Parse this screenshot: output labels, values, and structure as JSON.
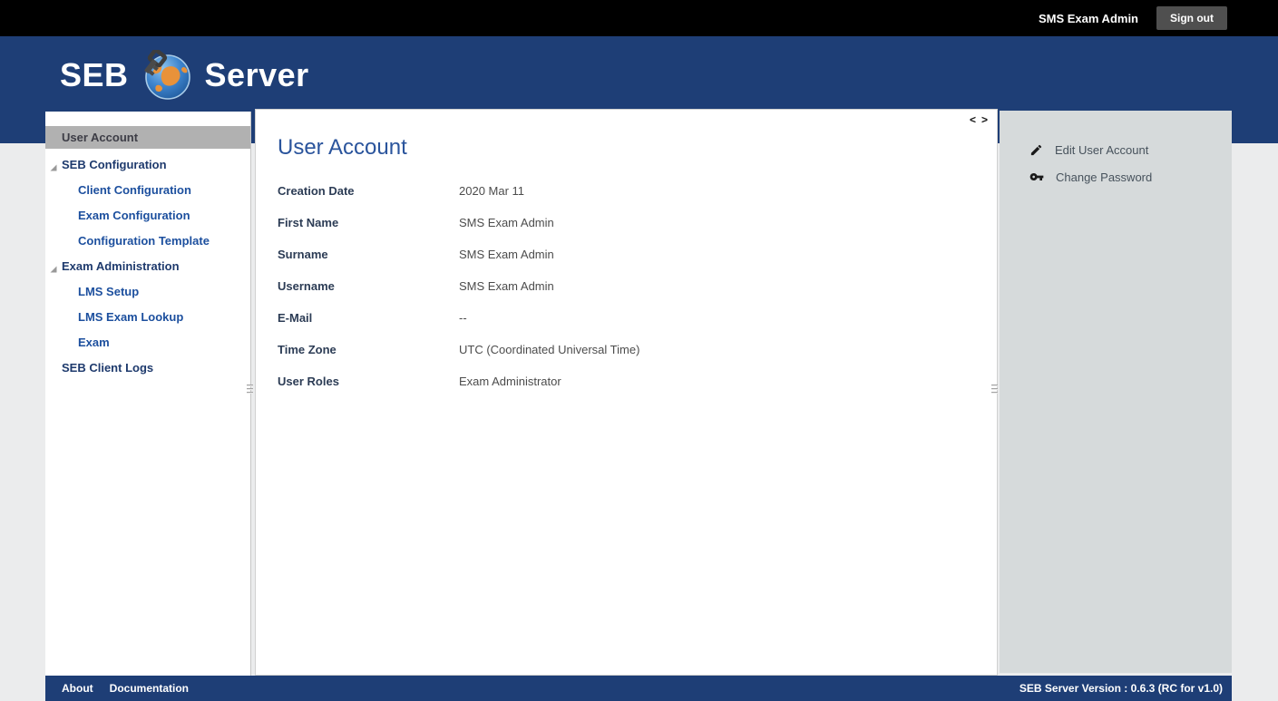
{
  "topbar": {
    "username": "SMS Exam Admin",
    "sign_out_label": "Sign out"
  },
  "logo": {
    "text_left": "SEB",
    "text_right": "Server"
  },
  "sidebar": {
    "items": [
      {
        "label": "User Account",
        "type": "top",
        "selected": true
      },
      {
        "label": "SEB Configuration",
        "type": "group"
      },
      {
        "label": "Client Configuration",
        "type": "sub"
      },
      {
        "label": "Exam Configuration",
        "type": "sub"
      },
      {
        "label": "Configuration Template",
        "type": "sub"
      },
      {
        "label": "Exam Administration",
        "type": "group"
      },
      {
        "label": "LMS Setup",
        "type": "sub"
      },
      {
        "label": "LMS Exam Lookup",
        "type": "sub"
      },
      {
        "label": "Exam",
        "type": "sub"
      },
      {
        "label": "SEB Client Logs",
        "type": "top"
      }
    ]
  },
  "content": {
    "title": "User Account",
    "pager": {
      "prev": "<",
      "next": ">"
    },
    "fields": [
      {
        "label": "Creation Date",
        "value": "2020 Mar 11"
      },
      {
        "label": "First Name",
        "value": "SMS Exam Admin"
      },
      {
        "label": "Surname",
        "value": "SMS Exam Admin"
      },
      {
        "label": "Username",
        "value": "SMS Exam Admin"
      },
      {
        "label": "E-Mail",
        "value": "--"
      },
      {
        "label": "Time Zone",
        "value": "UTC (Coordinated Universal Time)"
      },
      {
        "label": "User Roles",
        "value": "Exam Administrator"
      }
    ]
  },
  "actions": {
    "items": [
      {
        "icon": "pencil-icon",
        "label": "Edit User Account"
      },
      {
        "icon": "key-icon",
        "label": "Change Password"
      }
    ]
  },
  "footer": {
    "links": [
      {
        "label": "About"
      },
      {
        "label": "Documentation"
      }
    ],
    "version": "SEB Server Version : 0.6.3 (RC for v1.0)"
  },
  "colors": {
    "header_navy": "#1e3e76",
    "topbar_black": "#000000",
    "selected_item_bg": "#b1b1b1",
    "action_panel_bg": "#d6dadb",
    "page_bg": "#ebeced",
    "title_blue": "#2a549c",
    "nav_top_color": "#1e3a6d",
    "nav_sub_color": "#1c4f9e",
    "signout_bg": "#4f4f4f",
    "globe_orange": "#e8923a"
  }
}
